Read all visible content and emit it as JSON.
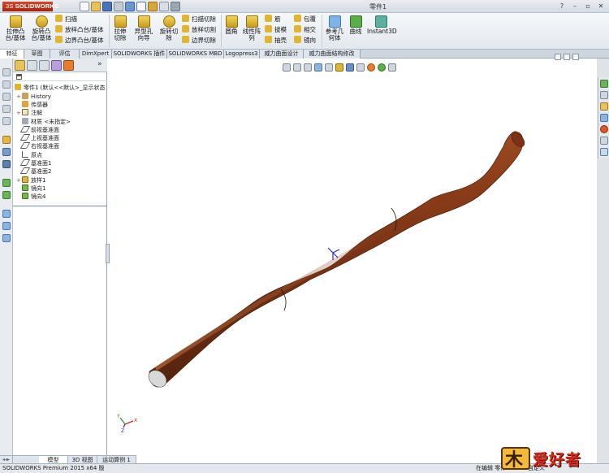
{
  "app": {
    "logo_text": "SOLIDWORKS",
    "document_title": "零件1",
    "window_help": "?"
  },
  "ribbon": {
    "extrude_boss": "拉伸凸台/基体",
    "revolve_boss": "旋转凸台/基体",
    "sweep": "扫描",
    "loft_boss": "放样凸台/基体",
    "boundary_boss": "边界凸台/基体",
    "extrude_cut": "拉伸切除",
    "hole_wizard": "异型孔向导",
    "revolve_cut": "旋转切除",
    "swept_cut": "扫描切除",
    "lofted_cut": "放样切割",
    "boundary_cut": "边界切除",
    "fillet": "圆角",
    "linear_pattern": "线性阵列",
    "rib": "筋",
    "draft": "拔模",
    "shell": "抽壳",
    "wrap": "包覆",
    "intersect": "相交",
    "mirror": "镜向",
    "reference_geometry": "参考几何体",
    "curves": "曲线",
    "instant3d": "Instant3D"
  },
  "tabs": [
    "特征",
    "草图",
    "评估",
    "DimXpert",
    "SOLIDWORKS 插件",
    "SOLIDWORKS MBD",
    "Logopress3",
    "威力曲面设计",
    "威力曲面结构修改"
  ],
  "tree": {
    "root": "零件1  (默认<<默认>_显示状态",
    "items": [
      {
        "label": "History",
        "expander": "+"
      },
      {
        "label": "传感器",
        "expander": ""
      },
      {
        "label": "注解",
        "expander": "+"
      },
      {
        "label": "材质 <未指定>",
        "expander": ""
      },
      {
        "label": "前视基准面",
        "expander": ""
      },
      {
        "label": "上视基准面",
        "expander": ""
      },
      {
        "label": "右视基准面",
        "expander": ""
      },
      {
        "label": "原点",
        "expander": ""
      },
      {
        "label": "基准面1",
        "expander": ""
      },
      {
        "label": "基准面2",
        "expander": ""
      },
      {
        "label": "放样1",
        "expander": "+"
      },
      {
        "label": "镜向1",
        "expander": ""
      },
      {
        "label": "镜向4",
        "expander": ""
      }
    ]
  },
  "bottom_tabs": [
    "模型",
    "3D 视图",
    "运动算例 1"
  ],
  "status": {
    "left": "SOLIDWORKS Premium 2015 x64 版",
    "middle": "在编辑 零件",
    "right": "自定义"
  },
  "watermark": {
    "text": "爱好者"
  },
  "colors": {
    "wood_dark": "#4a1e0c",
    "wood_mid": "#8a3c18",
    "wood_light": "#b9622f",
    "accent_blue": "#1a57a8",
    "logo_red": "#c2361b"
  }
}
